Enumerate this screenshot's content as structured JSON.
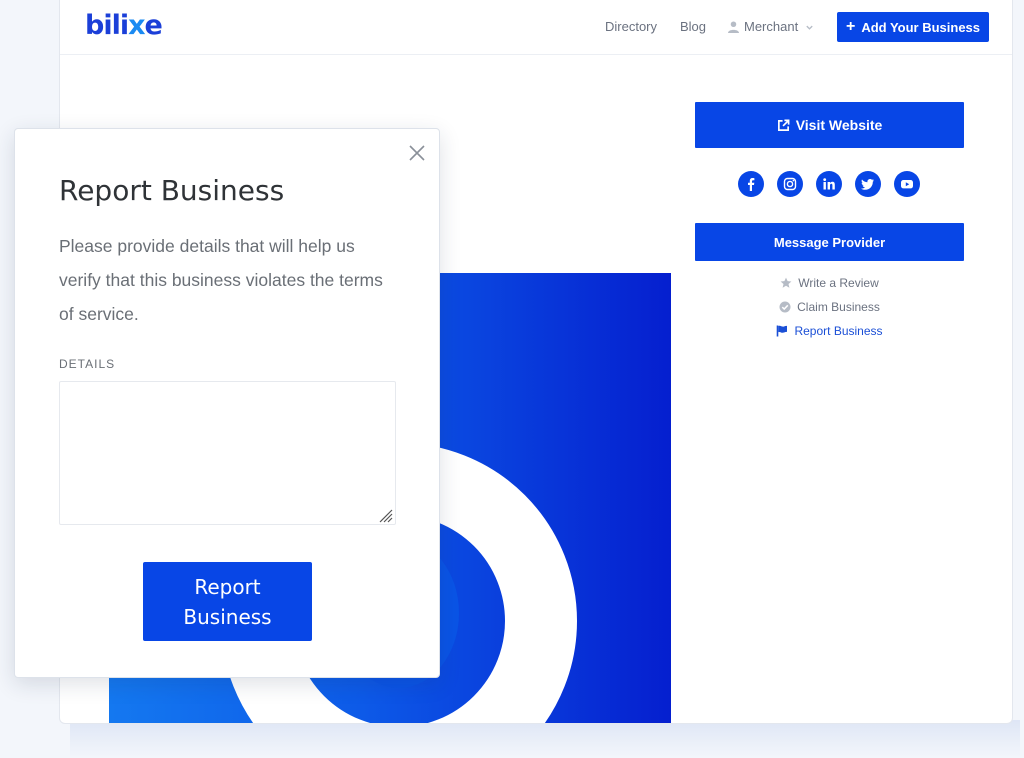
{
  "header": {
    "logo_text": "bilixe",
    "nav": {
      "directory": "Directory",
      "blog": "Blog",
      "merchant": "Merchant"
    },
    "add_business": "Add Your Business"
  },
  "sidebar": {
    "visit_website": "Visit Website",
    "socials": [
      "facebook-icon",
      "instagram-icon",
      "linkedin-icon",
      "twitter-icon",
      "youtube-icon"
    ],
    "message_provider": "Message Provider",
    "write_review": "Write a Review",
    "claim_business": "Claim Business",
    "report_business": "Report Business"
  },
  "modal": {
    "title": "Report Business",
    "description": "Please provide details that will help us verify that this business violates the terms of service.",
    "details_label": "DETAILS",
    "details_value": "",
    "submit": "Report Business"
  },
  "colors": {
    "primary": "#0846e6",
    "link": "#1b4fd6",
    "muted": "#6b7280"
  }
}
